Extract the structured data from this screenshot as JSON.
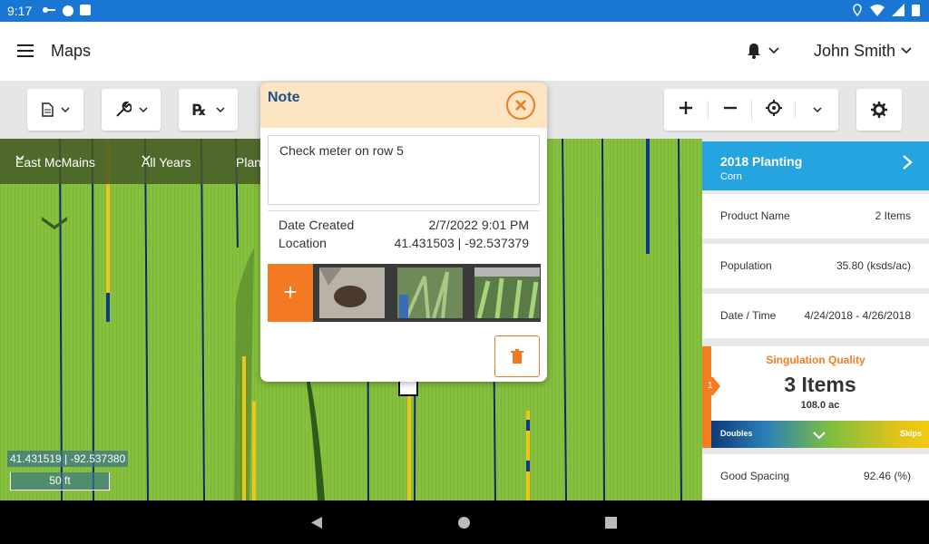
{
  "status_bar": {
    "time": "9:17"
  },
  "app_bar": {
    "title": "Maps",
    "user_name": "John Smith"
  },
  "map": {
    "filters": [
      "East McMains",
      "All Years",
      "Plan"
    ],
    "coordinate_readout": "41.431519 | -92.537380",
    "scale_label": "50 ft"
  },
  "note": {
    "title": "Note",
    "text": "Check meter on row 5",
    "date_created_label": "Date Created",
    "date_created_value": "2/7/2022 9:01 PM",
    "location_label": "Location",
    "location_value": "41.431503 | -92.537379",
    "add_photo_label": "+"
  },
  "panel": {
    "planting_title": "2018 Planting",
    "planting_subtitle": "Corn",
    "rows": [
      {
        "label": "Product Name",
        "value": "2 Items"
      },
      {
        "label": "Population",
        "value": "35.80 (ksds/ac)"
      },
      {
        "label": "Date / Time",
        "value": "4/24/2018 - 4/26/2018"
      }
    ],
    "singulation": {
      "tab_number": "1",
      "title": "Singulation Quality",
      "count": "3 Items",
      "area": "108.0 ac",
      "left_label": "Doubles",
      "right_label": "Skips"
    },
    "good_spacing": {
      "label": "Good Spacing",
      "value": "92.46 (%)"
    }
  },
  "colors": {
    "status_bar": "#1976d2",
    "accent_orange": "#f47a22",
    "panel_header": "#26a4e0",
    "note_header": "#fde5c2",
    "map_green": "#86c03e"
  }
}
